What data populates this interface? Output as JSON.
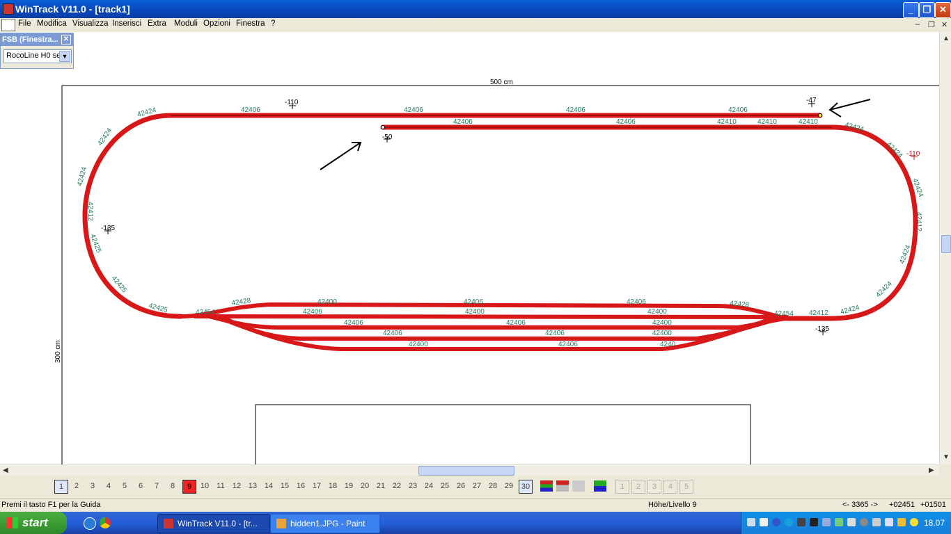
{
  "window": {
    "title": "WinTrack  V11.0 - [track1]"
  },
  "menu": {
    "items": [
      "File",
      "Modifica",
      "Visualizza",
      "Inserisci",
      "Extra",
      "Moduli",
      "Opzioni",
      "Finestra",
      "?"
    ]
  },
  "fsb": {
    "title": "FSB (Finestra...",
    "select_value": "RocoLine H0 se"
  },
  "plan": {
    "width_label": "500 cm",
    "height_label": "300 cm",
    "heights": [
      "-110",
      "-47",
      "-50",
      "-135",
      "-110",
      "-135"
    ],
    "track_labels": {
      "top_straights": [
        "42406",
        "42406",
        "42406",
        "42406"
      ],
      "inner_straights": [
        "42406",
        "42406",
        "42410",
        "42410",
        "42410"
      ],
      "left_curve": [
        "42424",
        "42424",
        "42424",
        "42412",
        "42425",
        "42425",
        "42425",
        "42454"
      ],
      "right_curve": [
        "42424",
        "42424",
        "42424",
        "42412",
        "42424",
        "42424",
        "42424",
        "42412"
      ],
      "yard_top": [
        "42428",
        "42400",
        "42406",
        "42406",
        "42428",
        "42454"
      ],
      "yard_row1": [
        "42406",
        "42400",
        "42400"
      ],
      "yard_row2": [
        "42406",
        "42406",
        "42400"
      ],
      "yard_row3": [
        "42406",
        "42406",
        "42400"
      ],
      "yard_row4": [
        "42400",
        "42406",
        "4240"
      ]
    }
  },
  "layerbar": {
    "layers": [
      "1",
      "2",
      "3",
      "4",
      "5",
      "6",
      "7",
      "8",
      "9",
      "10",
      "11",
      "12",
      "13",
      "14",
      "15",
      "16",
      "17",
      "18",
      "19",
      "20",
      "21",
      "22",
      "23",
      "24",
      "25",
      "26",
      "27",
      "28",
      "29",
      "30"
    ],
    "extra": [
      "1",
      "2",
      "3",
      "4",
      "5"
    ]
  },
  "status": {
    "help": "Premi il tasto F1 per la Guida",
    "level": "Höhe/Livello 9",
    "x_info": "<- 3365 ->",
    "coord_x": "+02451",
    "coord_y": "+01501"
  },
  "taskbar": {
    "start_label": "start",
    "tasks": [
      "WinTrack  V11.0 - [tr...",
      "hidden1.JPG - Paint"
    ],
    "clock": "18.07"
  },
  "colors": {
    "track": "#e8201e",
    "label": "#1f7a5a",
    "titlebar": "#0a5fd8"
  }
}
